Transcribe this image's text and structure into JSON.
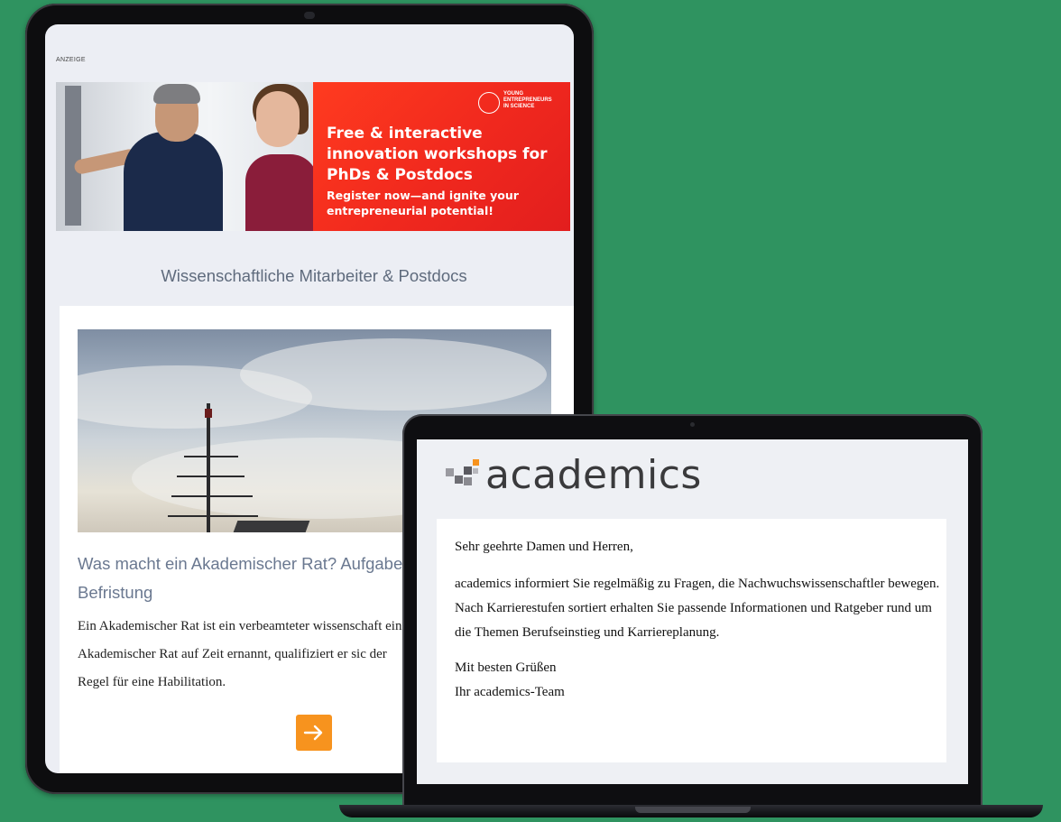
{
  "tablet": {
    "ad_label": "ANZEIGE",
    "ad": {
      "logo_text": "YOUNG\nENTREPRENEURS\nIN SCIENCE",
      "headline": "Free & interactive innovation workshops for PhDs & Postdocs",
      "subline": "Register now—and ignite your entrepreneurial potential!"
    },
    "section_title": "Wissenschaftliche Mitarbeiter & Postdocs",
    "article": {
      "title": "Was macht ein Akademischer Rat? Aufgabe Befristung",
      "text": "Ein Akademischer Rat ist ein verbeamteter wissenschaft ein Akademischer Rat auf Zeit ernannt, qualifiziert er sic der Regel für eine Habilitation.",
      "button_icon": "arrow-right-icon"
    }
  },
  "laptop": {
    "logo_text": "academics",
    "mail": {
      "greeting": "Sehr geehrte Damen und Herren,",
      "body": "academics informiert Sie regelmäßig zu Fragen, die Nachwuchswissenschaftler bewegen. Nach Karrierestufen sortiert erhalten Sie passende Informationen und Ratgeber rund um die Themen Berufseinstieg und Karriereplanung.",
      "closing_1": "Mit besten Grüßen",
      "closing_2": "Ihr academics-Team"
    }
  },
  "colors": {
    "background": "#2f9360",
    "ad_red": "#f0281e",
    "accent_orange": "#f7931e",
    "heading_gray": "#5f6b7d"
  }
}
